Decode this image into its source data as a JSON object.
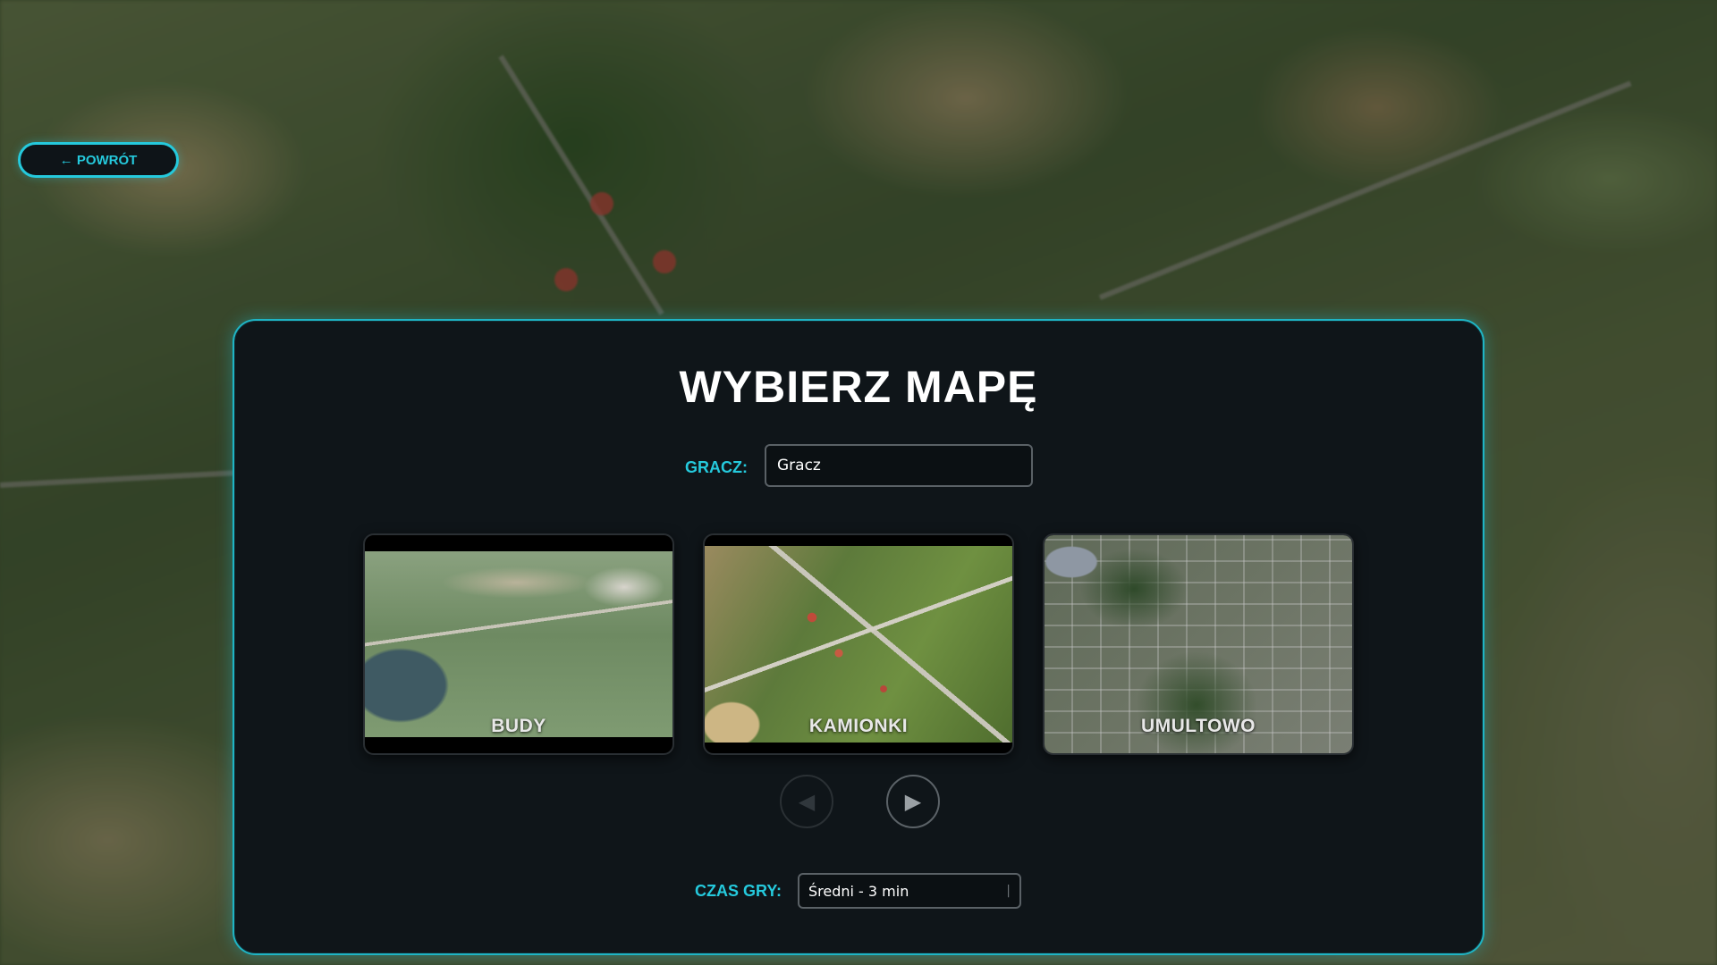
{
  "back_button": {
    "label": "← POWRÓT"
  },
  "panel": {
    "title": "WYBIERZ MAPĘ",
    "player": {
      "label": "GRACZ:",
      "value": "Gracz"
    },
    "maps": [
      {
        "name": "BUDY"
      },
      {
        "name": "KAMIONKI"
      },
      {
        "name": "UMULTOWO"
      }
    ],
    "carousel": {
      "prev_icon": "triangle-left-icon",
      "next_icon": "triangle-right-icon",
      "prev_glyph": "◀",
      "next_glyph": "▶",
      "prev_enabled": false
    },
    "game_time": {
      "label": "CZAS GRY:",
      "selected": "Średni - 3 min"
    }
  },
  "colors": {
    "accent": "#25c9dc",
    "panel_bg": "#0f1519"
  }
}
